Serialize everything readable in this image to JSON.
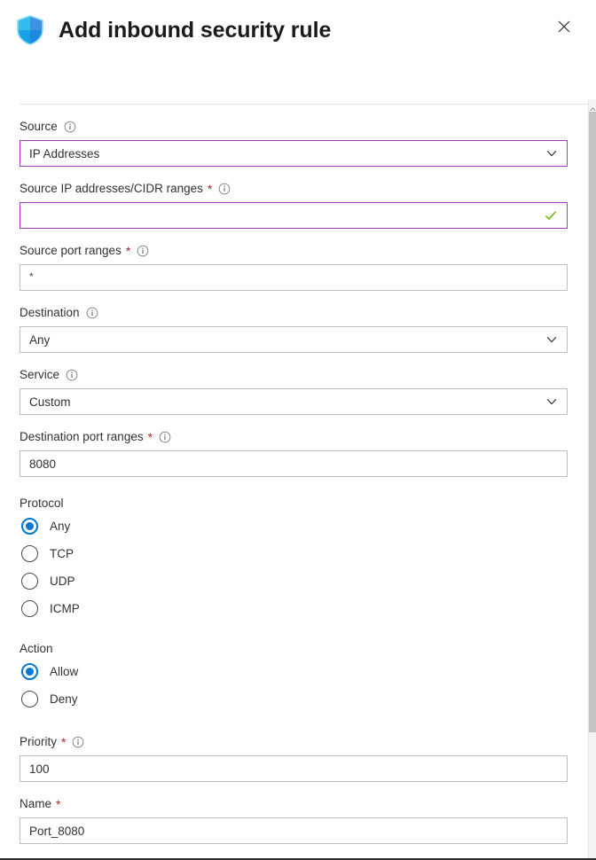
{
  "header": {
    "title": "Add inbound security rule",
    "icon": "shield-icon",
    "close_label": "Close"
  },
  "form": {
    "fields": [
      {
        "key": "source",
        "label": "Source",
        "required": false,
        "has_info": true,
        "control": "dropdown",
        "value": "IP Addresses",
        "focused": true
      },
      {
        "key": "source_ip_cidr",
        "label": "Source IP addresses/CIDR ranges",
        "required": true,
        "has_info": true,
        "control": "textbox",
        "value": "",
        "focused": true,
        "validated": true
      },
      {
        "key": "source_port_ranges",
        "label": "Source port ranges",
        "required": true,
        "has_info": true,
        "control": "textbox",
        "value": "*",
        "focused": false
      },
      {
        "key": "destination",
        "label": "Destination",
        "required": false,
        "has_info": true,
        "control": "dropdown",
        "value": "Any",
        "focused": false
      },
      {
        "key": "service",
        "label": "Service",
        "required": false,
        "has_info": true,
        "control": "dropdown",
        "value": "Custom",
        "focused": false
      },
      {
        "key": "destination_port_ranges",
        "label": "Destination port ranges",
        "required": true,
        "has_info": true,
        "control": "textbox",
        "value": "8080",
        "focused": false
      }
    ],
    "protocol": {
      "label": "Protocol",
      "options": [
        "Any",
        "TCP",
        "UDP",
        "ICMP"
      ],
      "selected": "Any"
    },
    "action": {
      "label": "Action",
      "options": [
        "Allow",
        "Deny"
      ],
      "selected": "Allow"
    },
    "priority": {
      "label": "Priority",
      "required": true,
      "has_info": true,
      "value": "100"
    },
    "name": {
      "label": "Name",
      "required": true,
      "has_info": false,
      "value": "Port_8080"
    }
  },
  "colors": {
    "accent_blue": "#0078d4",
    "focus_purple": "#a53dbd",
    "required_red": "#a4262c",
    "valid_green": "#6bb700"
  }
}
